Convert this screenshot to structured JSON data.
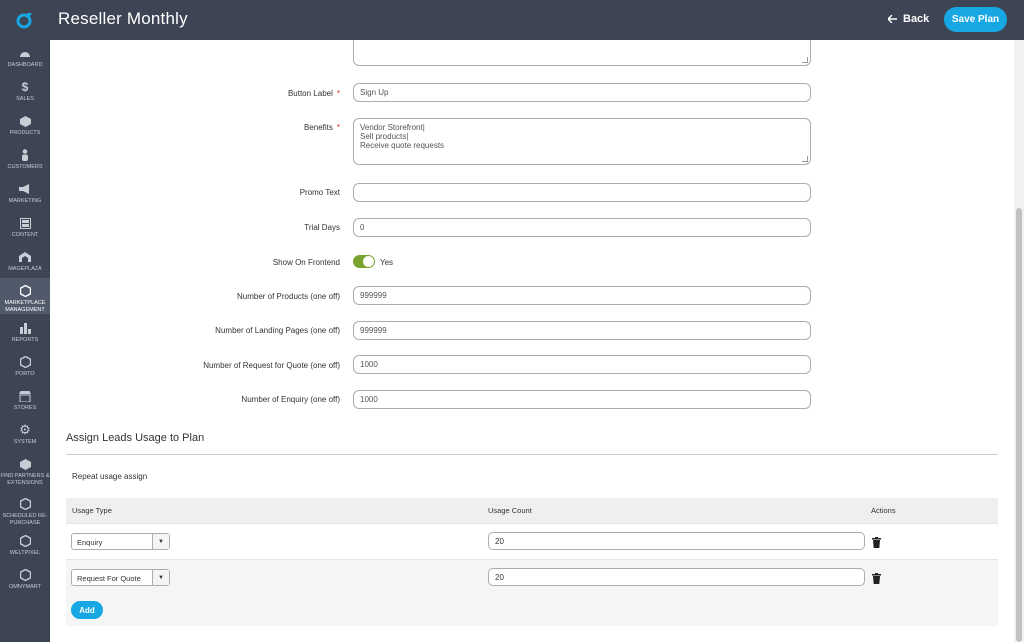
{
  "header": {
    "title": "Reseller Monthly",
    "back_label": "Back",
    "save_label": "Save Plan"
  },
  "sidebar": {
    "items": [
      {
        "label": "DASHBOARD",
        "icon": "dashboard-icon"
      },
      {
        "label": "SALES",
        "icon": "dollar-icon"
      },
      {
        "label": "PRODUCTS",
        "icon": "cube-icon"
      },
      {
        "label": "CUSTOMERS",
        "icon": "person-icon"
      },
      {
        "label": "MARKETING",
        "icon": "megaphone-icon"
      },
      {
        "label": "CONTENT",
        "icon": "layout-icon"
      },
      {
        "label": "MAGEPLAZA",
        "icon": "mageplaza-icon"
      },
      {
        "label": "MARKETPLACE MANAGEMENT",
        "icon": "hexagon-icon"
      },
      {
        "label": "REPORTS",
        "icon": "bar-chart-icon"
      },
      {
        "label": "PORTO",
        "icon": "hexagon-icon"
      },
      {
        "label": "STORES",
        "icon": "store-icon"
      },
      {
        "label": "SYSTEM",
        "icon": "gear-icon"
      },
      {
        "label": "FIND PARTNERS & EXTENSIONS",
        "icon": "box-icon"
      },
      {
        "label": "SCHEDULED RE-PURCHASE",
        "icon": "hexagon-icon"
      },
      {
        "label": "WELTPIXEL",
        "icon": "hexagon-icon"
      },
      {
        "label": "OMNYMART",
        "icon": "hexagon-icon"
      }
    ]
  },
  "form": {
    "button_label": {
      "label": "Button Label",
      "value": "Sign Up"
    },
    "benefits": {
      "label": "Benefits",
      "lines": [
        "Vendor Storefront|",
        "Sell products|",
        "Receive quote requests"
      ]
    },
    "promo_text": {
      "label": "Promo Text",
      "value": ""
    },
    "trial_days": {
      "label": "Trial Days",
      "value": "0"
    },
    "show_on_frontend": {
      "label": "Show On Frontend",
      "value": "Yes",
      "enabled": true
    },
    "num_products": {
      "label": "Number of Products (one off)",
      "value": "999999"
    },
    "num_landing": {
      "label": "Number of Landing Pages (one off)",
      "value": "999999"
    },
    "num_rfq": {
      "label": "Number of Request for Quote (one off)",
      "value": "1000"
    },
    "num_enquiry": {
      "label": "Number of Enquiry (one off)",
      "value": "1000"
    }
  },
  "leads": {
    "section_title": "Assign Leads Usage to Plan",
    "repeat_label": "Repeat usage assign",
    "columns": {
      "usage_type": "Usage Type",
      "usage_count": "Usage Count",
      "actions": "Actions"
    },
    "rows": [
      {
        "usage_type": "Enquiry",
        "usage_count": "20"
      },
      {
        "usage_type": "Request For Quote",
        "usage_count": "20"
      }
    ],
    "add_label": "Add"
  },
  "colors": {
    "header_bg": "#3d4454",
    "accent": "#17a8e3",
    "toggle_on": "#79a22e"
  }
}
